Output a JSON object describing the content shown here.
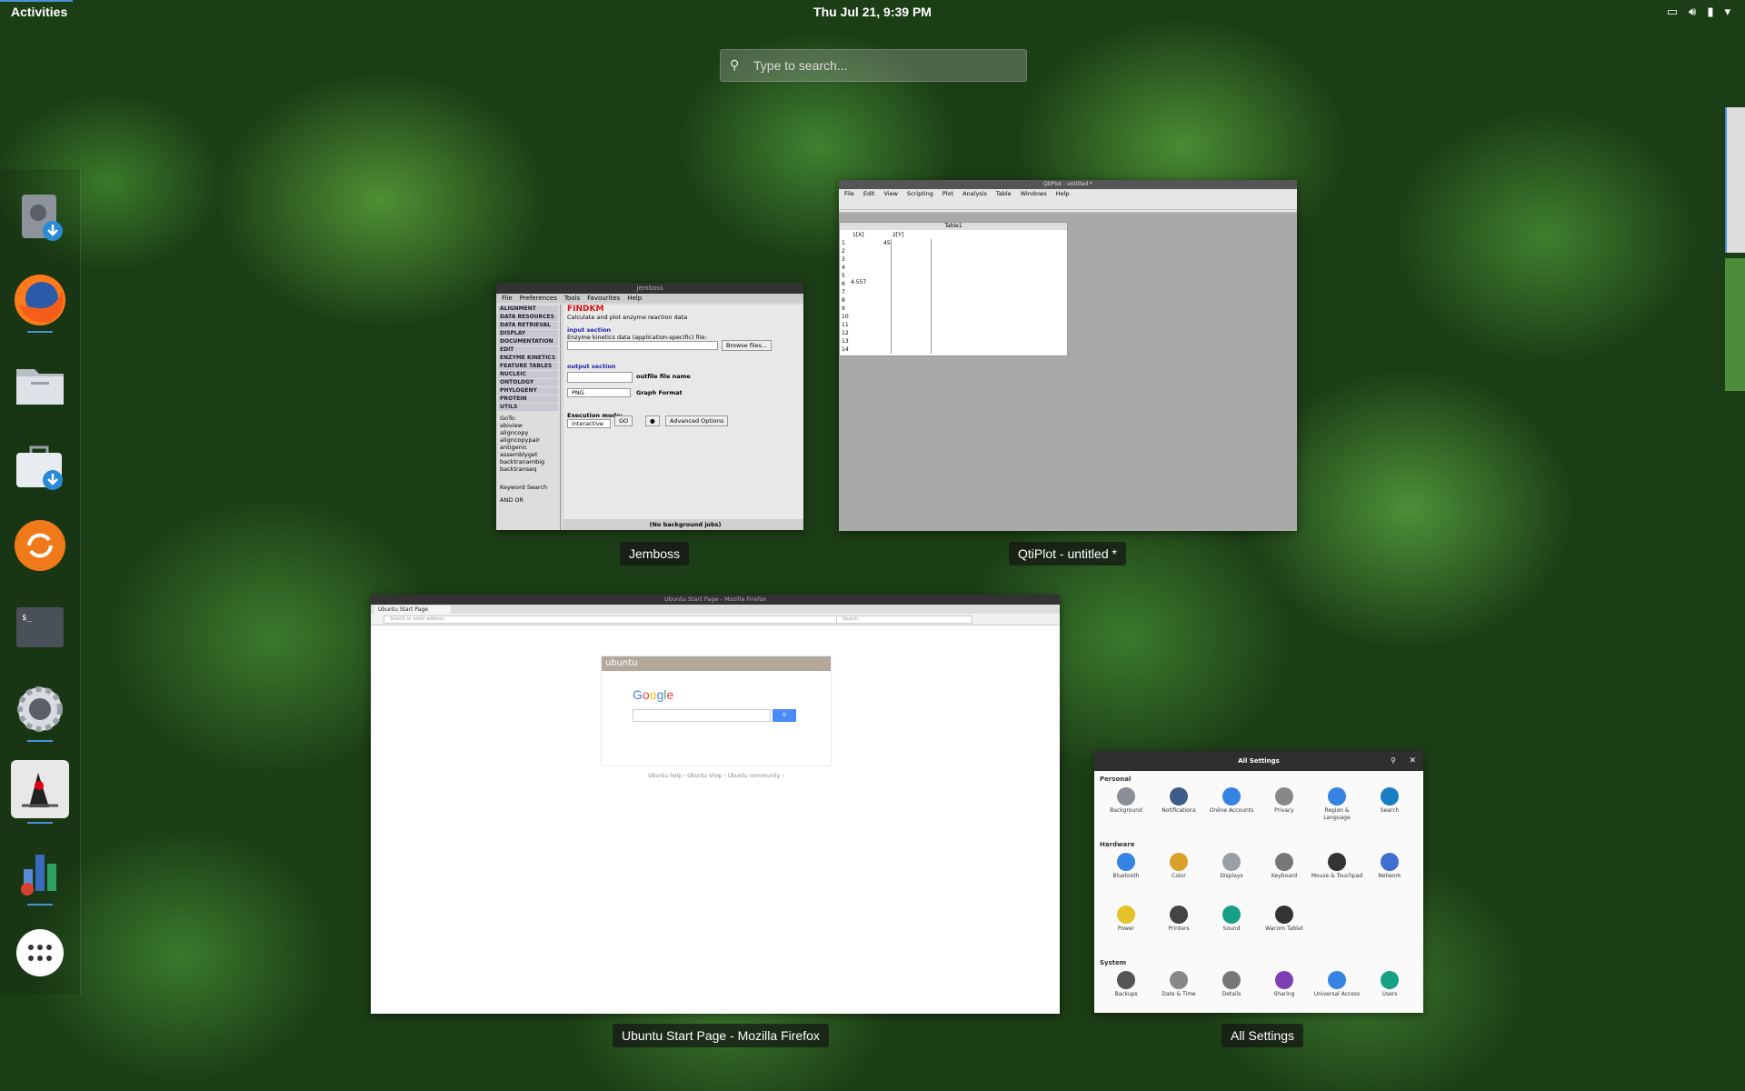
{
  "topbar": {
    "activities": "Activities",
    "clock": "Thu Jul 21,  9:39 PM"
  },
  "search": {
    "placeholder": "Type to search..."
  },
  "dash": {
    "items": [
      {
        "name": "Disk Usage / Installer",
        "icon": "installer-icon"
      },
      {
        "name": "Firefox",
        "icon": "firefox-icon"
      },
      {
        "name": "Files",
        "icon": "files-icon"
      },
      {
        "name": "Software",
        "icon": "software-icon"
      },
      {
        "name": "Software Updater",
        "icon": "updater-icon"
      },
      {
        "name": "Terminal",
        "icon": "terminal-icon"
      },
      {
        "name": "Settings",
        "icon": "settings-icon"
      },
      {
        "name": "Jemboss",
        "icon": "java-duke-icon"
      },
      {
        "name": "QtiPlot",
        "icon": "qtiplot-icon"
      },
      {
        "name": "Show Applications",
        "icon": "app-grid-icon"
      }
    ]
  },
  "windows": {
    "jemboss": {
      "title": "Jemboss",
      "titlebar": "Jemboss",
      "menu": [
        "File",
        "Preferences",
        "Tools",
        "Favourites",
        "Help"
      ],
      "categories": [
        "ALIGNMENT",
        "DATA RESOURCES",
        "DATA RETRIEVAL",
        "DISPLAY",
        "DOCUMENTATION",
        "EDIT",
        "ENZYME KINETICS",
        "FEATURE TABLES",
        "NUCLEIC",
        "ONTOLOGY",
        "PHYLOGENY",
        "PROTEIN",
        "UTILS"
      ],
      "goto": "GoTo:",
      "programs": [
        "abiview",
        "aligncopy",
        "aligncopypair",
        "antigenic",
        "assemblyget",
        "backtranambig",
        "backtranseq"
      ],
      "keyword": "Keyword Search",
      "and_or": "AND  OR",
      "program": "FINDKM",
      "description": "Calculate and plot enzyme reaction data",
      "input_section": "input section",
      "input_label": "Enzyme kinetics data (application-specific) file:",
      "browse": "Browse files...",
      "output_section": "output section",
      "outfile": "outfile file name",
      "format_value": "PNG",
      "format_label": "Graph Format",
      "exec_label": "Execution mode:",
      "exec_value": "interactive",
      "go": "GO",
      "advanced": "Advanced Options",
      "status": "(No background jobs)"
    },
    "qtiplot": {
      "title": "QtiPlot - untitled *",
      "titlebar": "QtiPlot - untitled *",
      "menu": [
        "File",
        "Edit",
        "View",
        "Scripting",
        "Plot",
        "Analysis",
        "Table",
        "Windows",
        "Help"
      ],
      "table_title": "Table1",
      "col1": "1[X]",
      "col2": "2[Y]",
      "cell_a": "45",
      "cell_b": "4.557",
      "rows": [
        "1",
        "2",
        "3",
        "4",
        "5",
        "6",
        "7",
        "8",
        "9",
        "10",
        "11",
        "12",
        "13",
        "14"
      ]
    },
    "firefox": {
      "title": "Ubuntu Start Page - Mozilla Firefox",
      "titlebar": "Ubuntu Start Page - Mozilla Firefox",
      "tab": "Ubuntu Start Page",
      "url_placeholder": "Search or enter address",
      "search_placeholder": "Search",
      "ubuntu": "ubuntu",
      "google": "Google",
      "footer": "Ubuntu help ›   Ubuntu shop ›   Ubuntu community ›"
    },
    "settings": {
      "title": "All Settings",
      "titlebar": "All Settings",
      "groups": [
        {
          "label": "Personal",
          "items": [
            {
              "label": "Background",
              "icon": "background-icon",
              "color": "#8a8f96"
            },
            {
              "label": "Notifications",
              "icon": "notifications-icon",
              "color": "#3b5d86"
            },
            {
              "label": "Online Accounts",
              "icon": "online-accounts-icon",
              "color": "#3584e4"
            },
            {
              "label": "Privacy",
              "icon": "privacy-icon",
              "color": "#888"
            },
            {
              "label": "Region & Language",
              "icon": "region-icon",
              "color": "#3584e4"
            },
            {
              "label": "Search",
              "icon": "search-icon",
              "color": "#1a7fc2"
            }
          ]
        },
        {
          "label": "Hardware",
          "items": [
            {
              "label": "Bluetooth",
              "icon": "bluetooth-icon",
              "color": "#3584e4"
            },
            {
              "label": "Color",
              "icon": "color-icon",
              "color": "#d9a02a"
            },
            {
              "label": "Displays",
              "icon": "displays-icon",
              "color": "#9aa0a8"
            },
            {
              "label": "Keyboard",
              "icon": "keyboard-icon",
              "color": "#777"
            },
            {
              "label": "Mouse & Touchpad",
              "icon": "mouse-icon",
              "color": "#333"
            },
            {
              "label": "Network",
              "icon": "network-icon",
              "color": "#3f6fd1"
            }
          ]
        },
        {
          "label": "",
          "items": [
            {
              "label": "Power",
              "icon": "power-icon",
              "color": "#e6c12a"
            },
            {
              "label": "Printers",
              "icon": "printers-icon",
              "color": "#444"
            },
            {
              "label": "Sound",
              "icon": "sound-icon",
              "color": "#16a085"
            },
            {
              "label": "Wacom Tablet",
              "icon": "wacom-icon",
              "color": "#333"
            }
          ]
        },
        {
          "label": "System",
          "items": [
            {
              "label": "Backups",
              "icon": "backups-icon",
              "color": "#555"
            },
            {
              "label": "Date & Time",
              "icon": "datetime-icon",
              "color": "#888"
            },
            {
              "label": "Details",
              "icon": "details-icon",
              "color": "#777"
            },
            {
              "label": "Sharing",
              "icon": "sharing-icon",
              "color": "#7e3fb5"
            },
            {
              "label": "Universal Access",
              "icon": "universal-access-icon",
              "color": "#3584e4"
            },
            {
              "label": "Users",
              "icon": "users-icon",
              "color": "#16a085"
            }
          ]
        }
      ]
    }
  },
  "colors": {
    "accent": "#4a90d9"
  }
}
